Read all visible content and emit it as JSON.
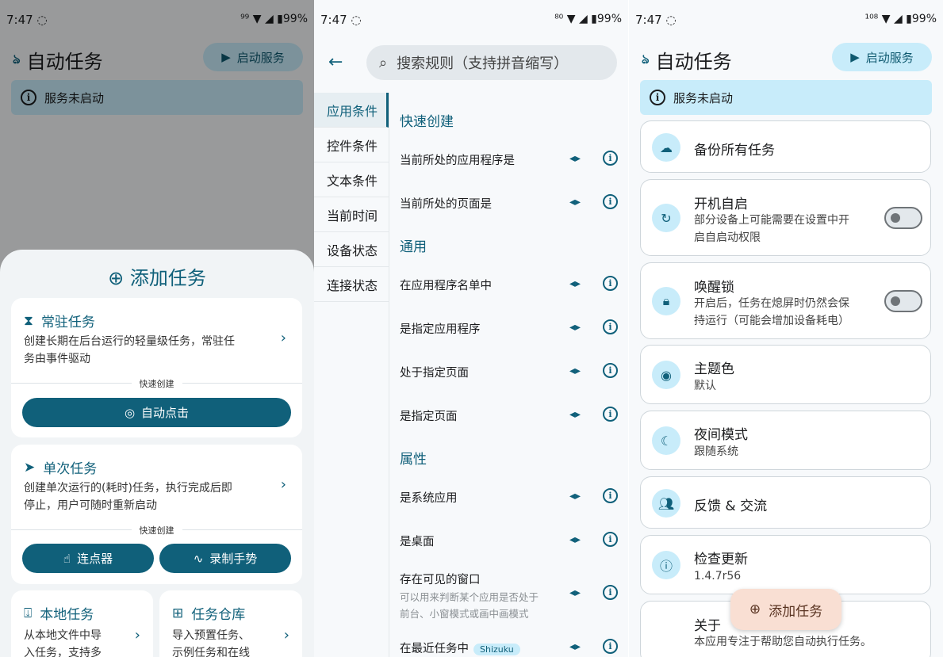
{
  "panel1": {
    "status": {
      "time": "7:47 ◌",
      "right": "⁹⁹ ▼ ◢ ▮99%"
    },
    "title": "自动任务",
    "start_service": "启动服务",
    "banner": "服务未启动",
    "sheet": {
      "title": "添加任务",
      "resident": {
        "title": "常驻任务",
        "desc1": "创建长期在后台运行的轻量级任务，常驻任",
        "desc2": "务由事件驱动",
        "quick": "快速创建",
        "btn": "自动点击"
      },
      "single": {
        "title": "单次任务",
        "desc1": "创建单次运行的(耗时)任务，执行完成后即",
        "desc2": "停止，用户可随时重新启动",
        "quick": "快速创建",
        "btn1": "连点器",
        "btn2": "录制手势"
      },
      "local": {
        "title": "本地任务",
        "desc1": "从本地文件中导",
        "desc2": "入任务，支持多"
      },
      "repo": {
        "title": "任务仓库",
        "desc1": "导入预置任务、",
        "desc2": "示例任务和在线"
      }
    }
  },
  "panel2": {
    "status": {
      "time": "7:47 ◌",
      "right": "⁸⁰ ▼ ◢ ▮99%"
    },
    "search_placeholder": "搜索规则（支持拼音缩写）",
    "sidebar": [
      "应用条件",
      "控件条件",
      "文本条件",
      "当前时间",
      "设备状态",
      "连接状态"
    ],
    "sections": {
      "quick": "快速创建",
      "general": "通用",
      "attr": "属性"
    },
    "rules": {
      "r1": "当前所处的应用程序是",
      "r2": "当前所处的页面是",
      "r3": "在应用程序名单中",
      "r4": "是指定应用程序",
      "r5": "处于指定页面",
      "r6": "是指定页面",
      "r7": "是系统应用",
      "r8": "是桌面",
      "r9": "存在可见的窗口",
      "r9_sub1": "可以用来判断某个应用是否处于",
      "r9_sub2": "前台、小窗模式或画中画模式",
      "r10": "在最近任务中",
      "r10_badge": "Shizuku"
    }
  },
  "panel3": {
    "status": {
      "time": "7:47 ◌",
      "right": "¹⁰⁸ ▼ ◢ ▮99%"
    },
    "title": "自动任务",
    "start_service": "启动服务",
    "banner": "服务未启动",
    "items": {
      "backup": "备份所有任务",
      "boot_title": "开机自启",
      "boot_sub1": "部分设备上可能需要在设置中开",
      "boot_sub2": "启自启动权限",
      "wake_title": "唤醒锁",
      "wake_sub1": "开启后，任务在熄屏时仍然会保",
      "wake_sub2": "持运行（可能会增加设备耗电）",
      "theme_title": "主题色",
      "theme_sub": "默认",
      "night_title": "夜间模式",
      "night_sub": "跟随系统",
      "feedback": "反馈 & 交流",
      "update_title": "检查更新",
      "update_sub": "1.4.7r56",
      "about_title": "关于",
      "about_sub": "本应用专注于帮助您自动执行任务。"
    },
    "fab": "添加任务"
  },
  "colors": {
    "primary": "#10607a",
    "tonal": "#c8ecfa",
    "fab": "#f9dfd3"
  }
}
